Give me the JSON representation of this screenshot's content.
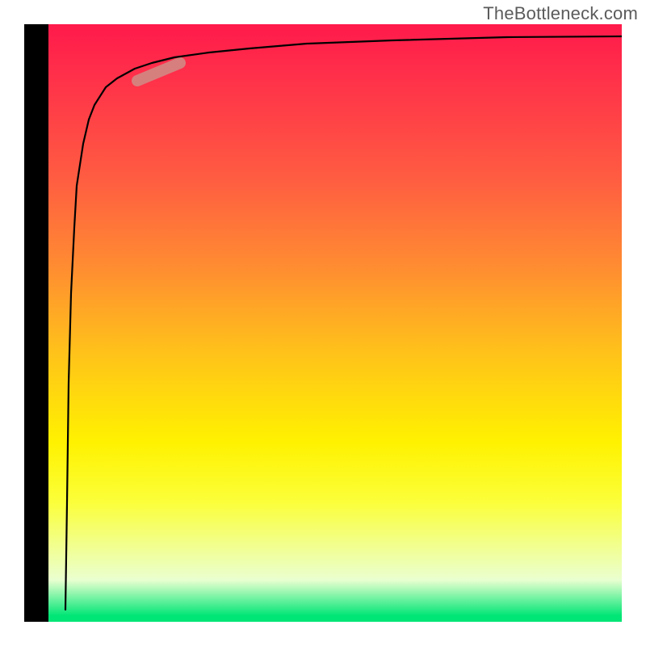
{
  "attribution": {
    "label": "TheBottleneck.com"
  },
  "colors": {
    "frame": "#000000",
    "curve": "#000000",
    "highlight": "#cf8e87",
    "gradient_stops": [
      "#ff1a4b",
      "#ff5a42",
      "#ffc21a",
      "#fff200",
      "#eaffd0",
      "#00e676"
    ]
  },
  "chart_data": {
    "type": "line",
    "title": "",
    "xlabel": "",
    "ylabel": "",
    "xlim": [
      0,
      100
    ],
    "ylim": [
      0,
      100
    ],
    "grid": false,
    "legend": false,
    "background": "vertical-gradient red→yellow→green",
    "note": "Axes are unlabeled in the source image; values are normalized 0–100 based on plot extent. y rises sharply near x≈3 then asymptotically approaches ~98.",
    "series": [
      {
        "name": "curve",
        "x": [
          3.0,
          3.3,
          3.6,
          4.0,
          4.5,
          5.0,
          6.0,
          7.0,
          8.0,
          10.0,
          12.0,
          15.0,
          18.0,
          22.0,
          28.0,
          35.0,
          45.0,
          60.0,
          80.0,
          100.0
        ],
        "y": [
          2.0,
          20.0,
          40.0,
          55.0,
          66.0,
          73.0,
          80.0,
          84.0,
          86.5,
          89.5,
          91.0,
          92.5,
          93.5,
          94.5,
          95.3,
          96.0,
          96.8,
          97.3,
          97.8,
          98.0
        ]
      }
    ],
    "highlight_segment": {
      "description": "short thick pink-brown segment on the curve",
      "x_range": [
        15.5,
        23.0
      ],
      "y_range": [
        90.5,
        93.5
      ]
    }
  }
}
